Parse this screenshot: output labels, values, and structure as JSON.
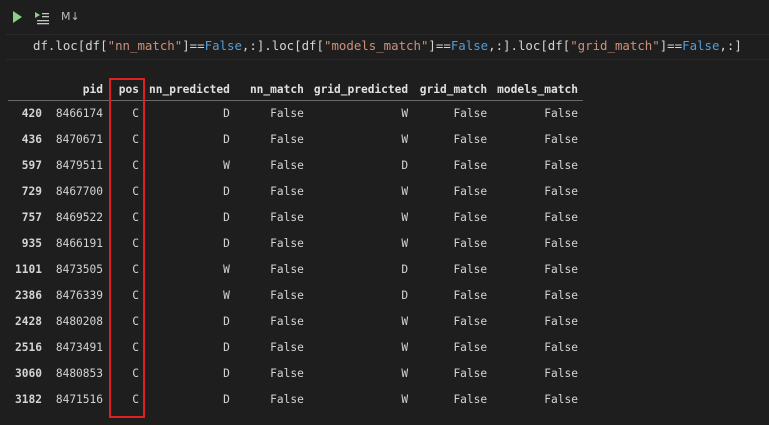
{
  "toolbar": {
    "run_icon": "play-icon",
    "run_below_icon": "run-below-icon",
    "cell_type_label": "M↓"
  },
  "code": {
    "parts": [
      "df.loc[df[",
      "\"nn_match\"",
      "]==",
      "False",
      ",:].loc[df[",
      "\"models_match\"",
      "]==",
      "False",
      ",:].loc[df[",
      "\"grid_match\"",
      "]==",
      "False",
      ",:]"
    ]
  },
  "table": {
    "columns": [
      "",
      "pid",
      "pos",
      "nn_predicted",
      "nn_match",
      "grid_predicted",
      "grid_match",
      "models_match"
    ],
    "rows": [
      {
        "index": "420",
        "pid": "8466174",
        "pos": "C",
        "nn_predicted": "D",
        "nn_match": "False",
        "grid_predicted": "W",
        "grid_match": "False",
        "models_match": "False"
      },
      {
        "index": "436",
        "pid": "8470671",
        "pos": "C",
        "nn_predicted": "D",
        "nn_match": "False",
        "grid_predicted": "W",
        "grid_match": "False",
        "models_match": "False"
      },
      {
        "index": "597",
        "pid": "8479511",
        "pos": "C",
        "nn_predicted": "W",
        "nn_match": "False",
        "grid_predicted": "D",
        "grid_match": "False",
        "models_match": "False"
      },
      {
        "index": "729",
        "pid": "8467700",
        "pos": "C",
        "nn_predicted": "D",
        "nn_match": "False",
        "grid_predicted": "W",
        "grid_match": "False",
        "models_match": "False"
      },
      {
        "index": "757",
        "pid": "8469522",
        "pos": "C",
        "nn_predicted": "D",
        "nn_match": "False",
        "grid_predicted": "W",
        "grid_match": "False",
        "models_match": "False"
      },
      {
        "index": "935",
        "pid": "8466191",
        "pos": "C",
        "nn_predicted": "D",
        "nn_match": "False",
        "grid_predicted": "W",
        "grid_match": "False",
        "models_match": "False"
      },
      {
        "index": "1101",
        "pid": "8473505",
        "pos": "C",
        "nn_predicted": "W",
        "nn_match": "False",
        "grid_predicted": "D",
        "grid_match": "False",
        "models_match": "False"
      },
      {
        "index": "2386",
        "pid": "8476339",
        "pos": "C",
        "nn_predicted": "W",
        "nn_match": "False",
        "grid_predicted": "D",
        "grid_match": "False",
        "models_match": "False"
      },
      {
        "index": "2428",
        "pid": "8480208",
        "pos": "C",
        "nn_predicted": "D",
        "nn_match": "False",
        "grid_predicted": "W",
        "grid_match": "False",
        "models_match": "False"
      },
      {
        "index": "2516",
        "pid": "8473491",
        "pos": "C",
        "nn_predicted": "D",
        "nn_match": "False",
        "grid_predicted": "W",
        "grid_match": "False",
        "models_match": "False"
      },
      {
        "index": "3060",
        "pid": "8480853",
        "pos": "C",
        "nn_predicted": "D",
        "nn_match": "False",
        "grid_predicted": "W",
        "grid_match": "False",
        "models_match": "False"
      },
      {
        "index": "3182",
        "pid": "8471516",
        "pos": "C",
        "nn_predicted": "D",
        "nn_match": "False",
        "grid_predicted": "W",
        "grid_match": "False",
        "models_match": "False"
      }
    ]
  },
  "colors": {
    "background": "#1e1e1e",
    "string": "#ce9178",
    "keyword": "#569cd6",
    "highlight_box": "#e02020",
    "run_icon": "#89d185"
  }
}
